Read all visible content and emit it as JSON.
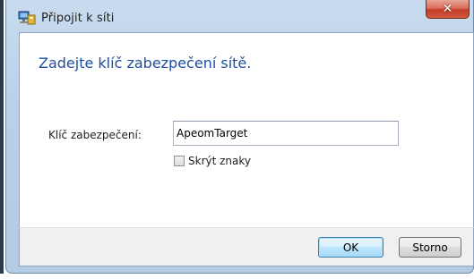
{
  "window": {
    "title": "Připojit k síti",
    "close_glyph": "✕"
  },
  "content": {
    "heading": "Zadejte klíč zabezpečení sítě.",
    "key_label": "Klíč zabezpečení:",
    "key_value": "ApeomTarget",
    "hide_chars_label": "Skrýt znaky",
    "hide_chars_checked": false
  },
  "buttons": {
    "ok_label": "OK",
    "cancel_label": "Storno"
  },
  "colors": {
    "heading": "#1f4e9c",
    "close_button": "#c43b26"
  },
  "icons": {
    "app": "network-connect-icon",
    "close": "close-icon"
  }
}
